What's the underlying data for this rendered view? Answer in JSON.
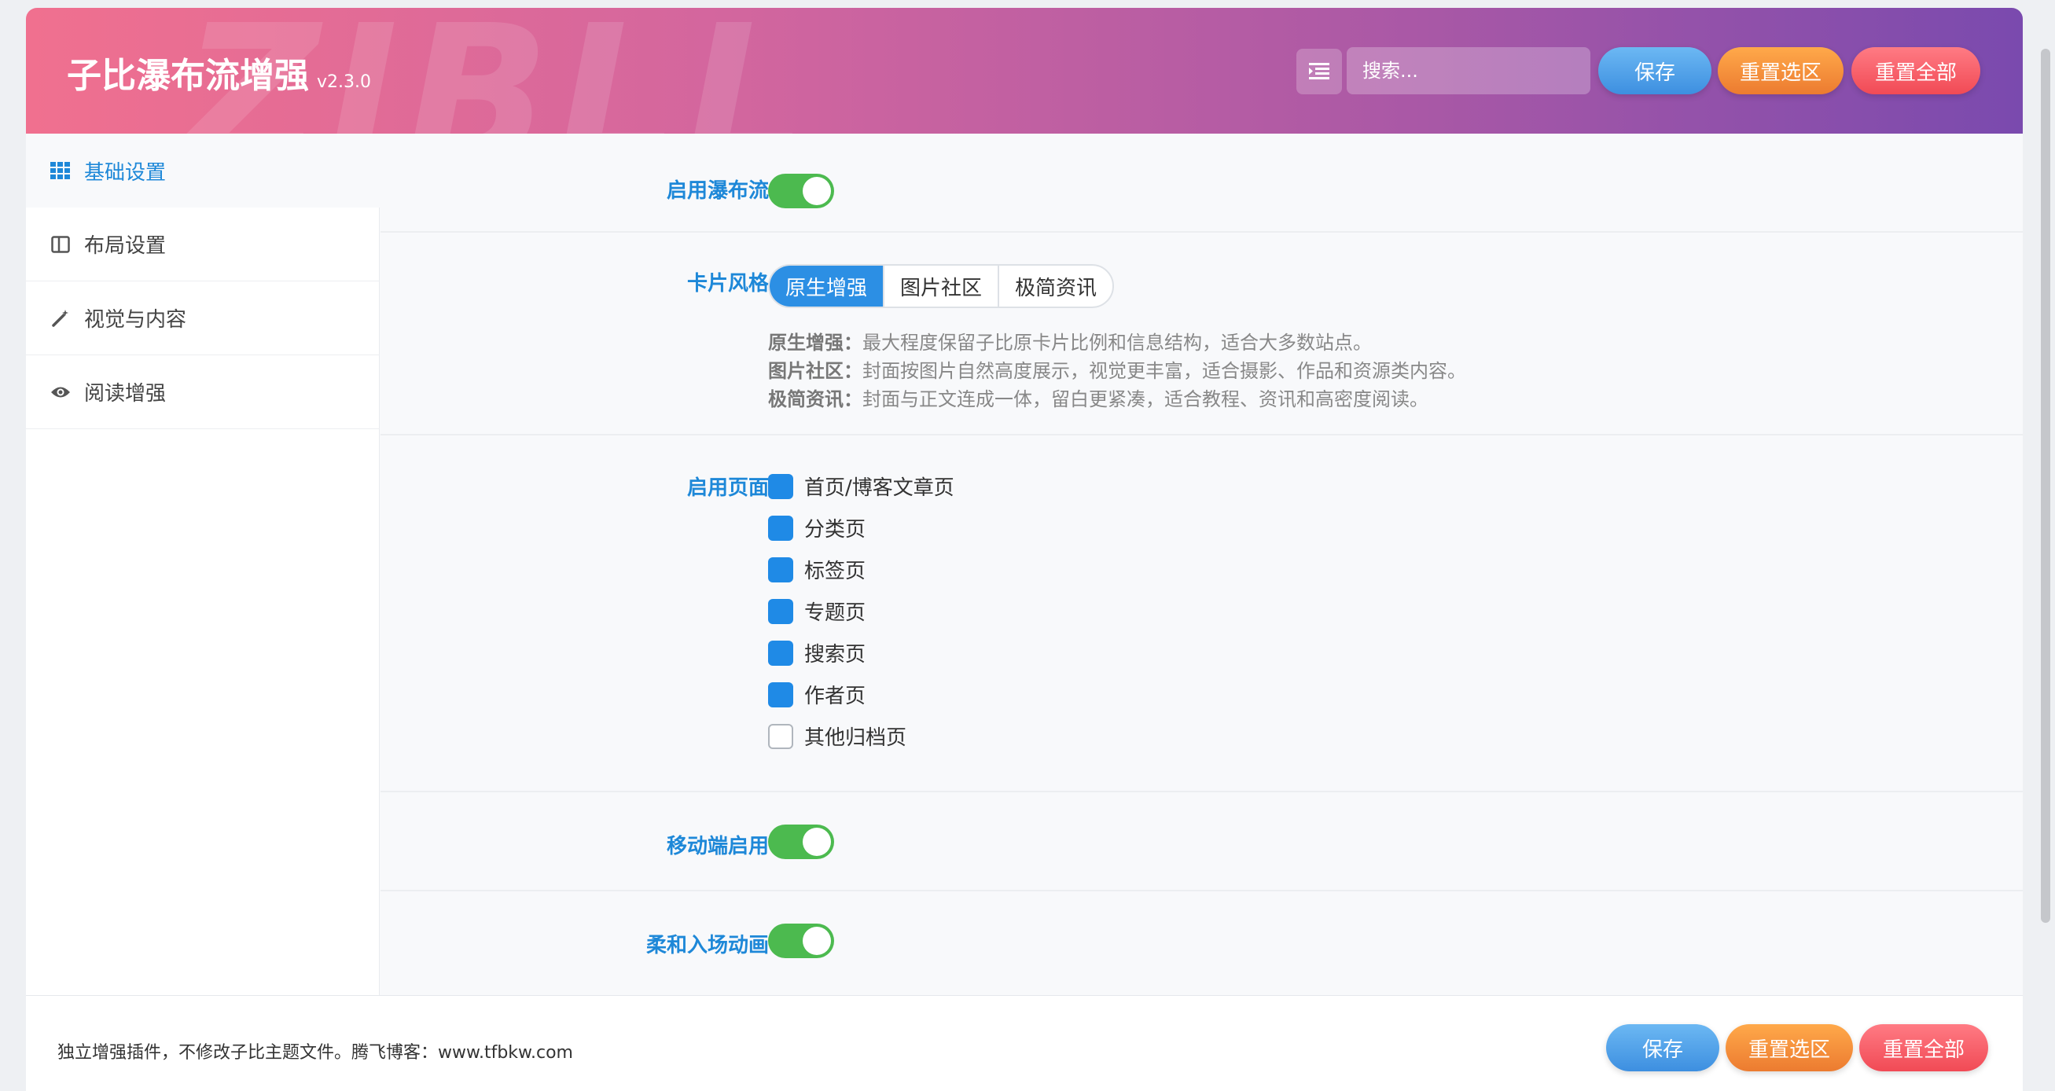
{
  "header": {
    "title": "子比瀑布流增强",
    "version": "v2.3.0",
    "watermark": "ZIBLL",
    "search_placeholder": "搜索...",
    "save": "保存",
    "reset_section": "重置选区",
    "reset_all": "重置全部"
  },
  "sidebar": {
    "items": [
      {
        "label": "基础设置",
        "icon": "grid-icon"
      },
      {
        "label": "布局设置",
        "icon": "columns-icon"
      },
      {
        "label": "视觉与内容",
        "icon": "magic-wand-icon"
      },
      {
        "label": "阅读增强",
        "icon": "eye-icon"
      }
    ]
  },
  "settings": {
    "enable_waterfall": {
      "label": "启用瀑布流",
      "value": true
    },
    "card_style": {
      "label": "卡片风格",
      "options": [
        "原生增强",
        "图片社区",
        "极简资讯"
      ],
      "selected": "原生增强",
      "descriptions": [
        {
          "name": "原生增强：",
          "text": "最大程度保留子比原卡片比例和信息结构，适合大多数站点。"
        },
        {
          "name": "图片社区：",
          "text": "封面按图片自然高度展示，视觉更丰富，适合摄影、作品和资源类内容。"
        },
        {
          "name": "极简资讯：",
          "text": "封面与正文连成一体，留白更紧凑，适合教程、资讯和高密度阅读。"
        }
      ]
    },
    "enable_pages": {
      "label": "启用页面",
      "items": [
        {
          "label": "首页/博客文章页",
          "checked": true
        },
        {
          "label": "分类页",
          "checked": true
        },
        {
          "label": "标签页",
          "checked": true
        },
        {
          "label": "专题页",
          "checked": true
        },
        {
          "label": "搜索页",
          "checked": true
        },
        {
          "label": "作者页",
          "checked": true
        },
        {
          "label": "其他归档页",
          "checked": false
        }
      ]
    },
    "mobile_enable": {
      "label": "移动端启用",
      "value": true
    },
    "soft_animation": {
      "label": "柔和入场动画",
      "value": true
    }
  },
  "footer": {
    "text": "独立增强插件，不修改子比主题文件。腾飞博客：www.tfbkw.com",
    "save": "保存",
    "reset_section": "重置选区",
    "reset_all": "重置全部"
  },
  "colors": {
    "accent": "#1e88d8",
    "toggle_on": "#4cba4f",
    "save": "#3d8fe0",
    "reset_section": "#ec7b30",
    "reset_all": "#f14a55"
  }
}
